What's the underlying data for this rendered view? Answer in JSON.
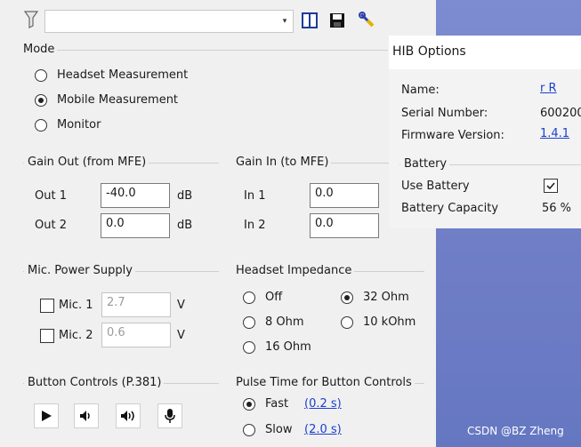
{
  "toolbar": {
    "dropdown_value": "",
    "dropdown_arrow": "▾",
    "icons": [
      "filter-icon",
      "columns-icon",
      "save-icon",
      "wrench-icon"
    ]
  },
  "mode": {
    "label": "Mode",
    "options": [
      "Headset Measurement",
      "Mobile Measurement",
      "Monitor"
    ],
    "selected": "Mobile Measurement"
  },
  "gain_out": {
    "label": "Gain Out (from MFE)",
    "rows": [
      {
        "label": "Out 1",
        "value": "-40.0",
        "unit": "dB"
      },
      {
        "label": "Out 2",
        "value": "0.0",
        "unit": "dB"
      }
    ]
  },
  "gain_in": {
    "label": "Gain In (to MFE)",
    "rows": [
      {
        "label": "In 1",
        "value": "0.0"
      },
      {
        "label": "In 2",
        "value": "0.0"
      }
    ]
  },
  "mic_power": {
    "label": "Mic. Power Supply",
    "rows": [
      {
        "label": "Mic. 1",
        "value": "2.7",
        "unit": "V"
      },
      {
        "label": "Mic. 2",
        "value": "0.6",
        "unit": "V"
      }
    ]
  },
  "headset_impedance": {
    "label": "Headset Impedance",
    "options": [
      "Off",
      "32 Ohm",
      "8 Ohm",
      "10 kOhm",
      "16 Ohm"
    ],
    "selected": "32 Ohm"
  },
  "button_controls": {
    "label": "Button Controls (P.381)",
    "buttons": [
      "play-icon",
      "volume-down-icon",
      "volume-up-icon",
      "microphone-icon"
    ]
  },
  "pulse_time": {
    "label": "Pulse Time for Button Controls",
    "options": [
      {
        "label": "Fast",
        "link": "(0.2 s)"
      },
      {
        "label": "Slow",
        "link": "(2.0 s)"
      }
    ],
    "selected": "Fast"
  },
  "hib_options": {
    "title": "HIB Options",
    "name_label": "Name:",
    "name_value": "r R",
    "serial_label": "Serial Number:",
    "serial_value": "600200",
    "firmware_label": "Firmware Version:",
    "firmware_value": "1.4.1",
    "battery_label": "Battery",
    "use_battery_label": "Use Battery",
    "use_battery_checked": true,
    "capacity_label": "Battery Capacity",
    "capacity_value": "56 %"
  },
  "watermark": "CSDN @BZ Zheng"
}
